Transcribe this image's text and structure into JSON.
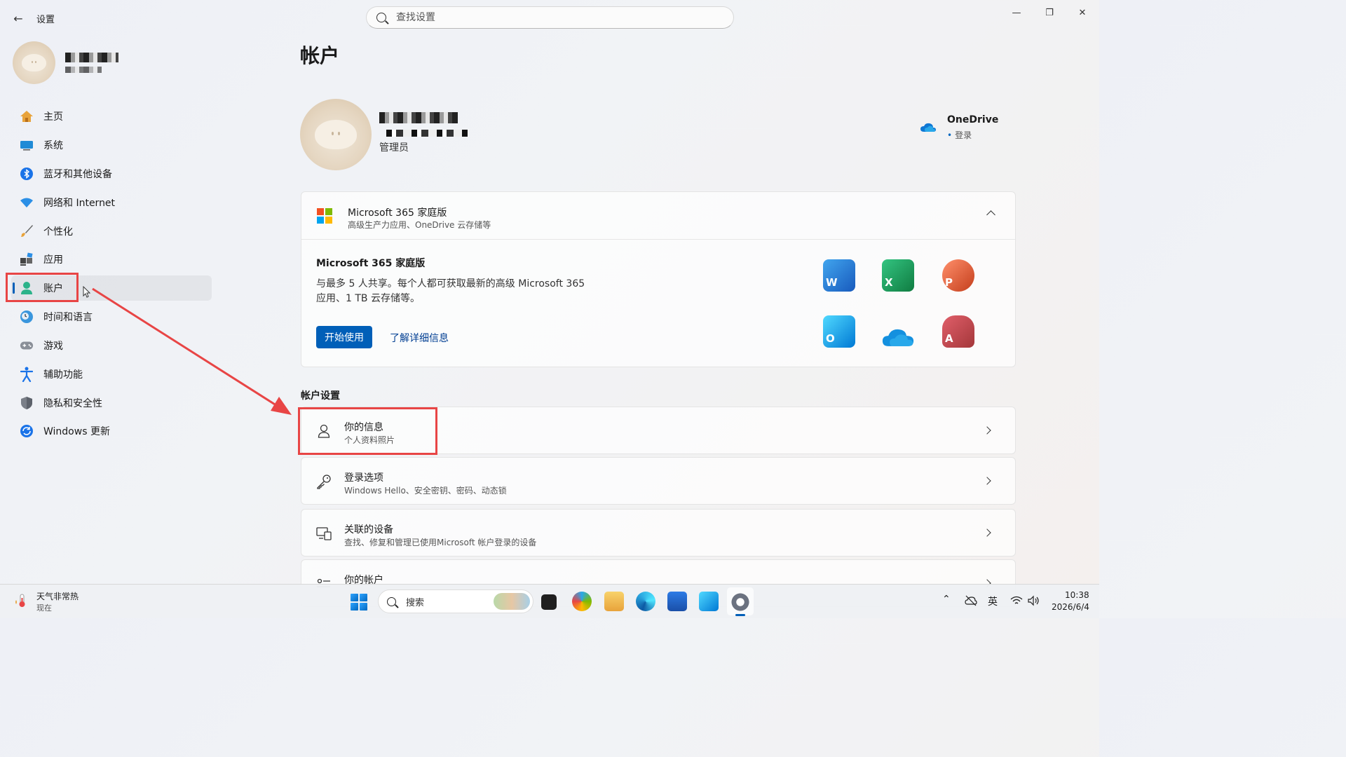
{
  "app": {
    "title": "设置"
  },
  "search": {
    "placeholder": "查找设置"
  },
  "window": {
    "minimize": "—",
    "restore": "❐",
    "close": "✕"
  },
  "sidebar": {
    "items": [
      {
        "label": "主页",
        "icon": "home-icon"
      },
      {
        "label": "系统",
        "icon": "monitor-icon"
      },
      {
        "label": "蓝牙和其他设备",
        "icon": "bluetooth-icon"
      },
      {
        "label": "网络和 Internet",
        "icon": "wifi-icon"
      },
      {
        "label": "个性化",
        "icon": "brush-icon"
      },
      {
        "label": "应用",
        "icon": "apps-icon"
      },
      {
        "label": "账户",
        "icon": "person-icon",
        "active": true
      },
      {
        "label": "时间和语言",
        "icon": "clock-globe-icon"
      },
      {
        "label": "游戏",
        "icon": "gamepad-icon"
      },
      {
        "label": "辅助功能",
        "icon": "accessibility-icon"
      },
      {
        "label": "隐私和安全性",
        "icon": "shield-icon"
      },
      {
        "label": "Windows 更新",
        "icon": "update-icon"
      }
    ]
  },
  "main": {
    "title": "帐户",
    "user": {
      "role": "管理员"
    },
    "onedrive": {
      "title": "OneDrive",
      "status": "登录"
    },
    "m365": {
      "header_title": "Microsoft 365 家庭版",
      "header_sub": "高级生产力应用、OneDrive 云存储等",
      "body_title": "Microsoft 365 家庭版",
      "desc": "与最多 5 人共享。每个人都可获取最新的高级 Microsoft 365 应用、1 TB 云存储等。",
      "primary_button": "开始使用",
      "link": "了解详细信息",
      "apps": [
        {
          "name": "Word",
          "letter": "W",
          "color": "#185abd"
        },
        {
          "name": "Excel",
          "letter": "X",
          "color": "#107c41"
        },
        {
          "name": "PowerPoint",
          "letter": "P",
          "color": "#c43e1c"
        },
        {
          "name": "Outlook",
          "letter": "O",
          "color": "#0078d4"
        },
        {
          "name": "OneDrive",
          "letter": "",
          "color": "#0364b8"
        },
        {
          "name": "Access",
          "letter": "A",
          "color": "#a4373a"
        }
      ]
    },
    "section_label": "帐户设置",
    "rows": [
      {
        "title": "你的信息",
        "sub": "个人资料照片",
        "icon": "person-outline-icon"
      },
      {
        "title": "登录选项",
        "sub": "Windows Hello、安全密钥、密码、动态锁",
        "icon": "key-icon"
      },
      {
        "title": "关联的设备",
        "sub": "查找、修复和管理已使用Microsoft 帐户登录的设备",
        "icon": "devices-icon"
      },
      {
        "title": "你的帐户",
        "sub": "",
        "icon": "list-person-icon"
      }
    ]
  },
  "taskbar": {
    "weather_title": "天气非常热",
    "weather_sub": "现在",
    "search_placeholder": "搜索",
    "ime": "英",
    "time": "10:38",
    "date": "2026/6/4"
  },
  "colors": {
    "accent": "#005fb8",
    "annotation": "#e84545"
  }
}
